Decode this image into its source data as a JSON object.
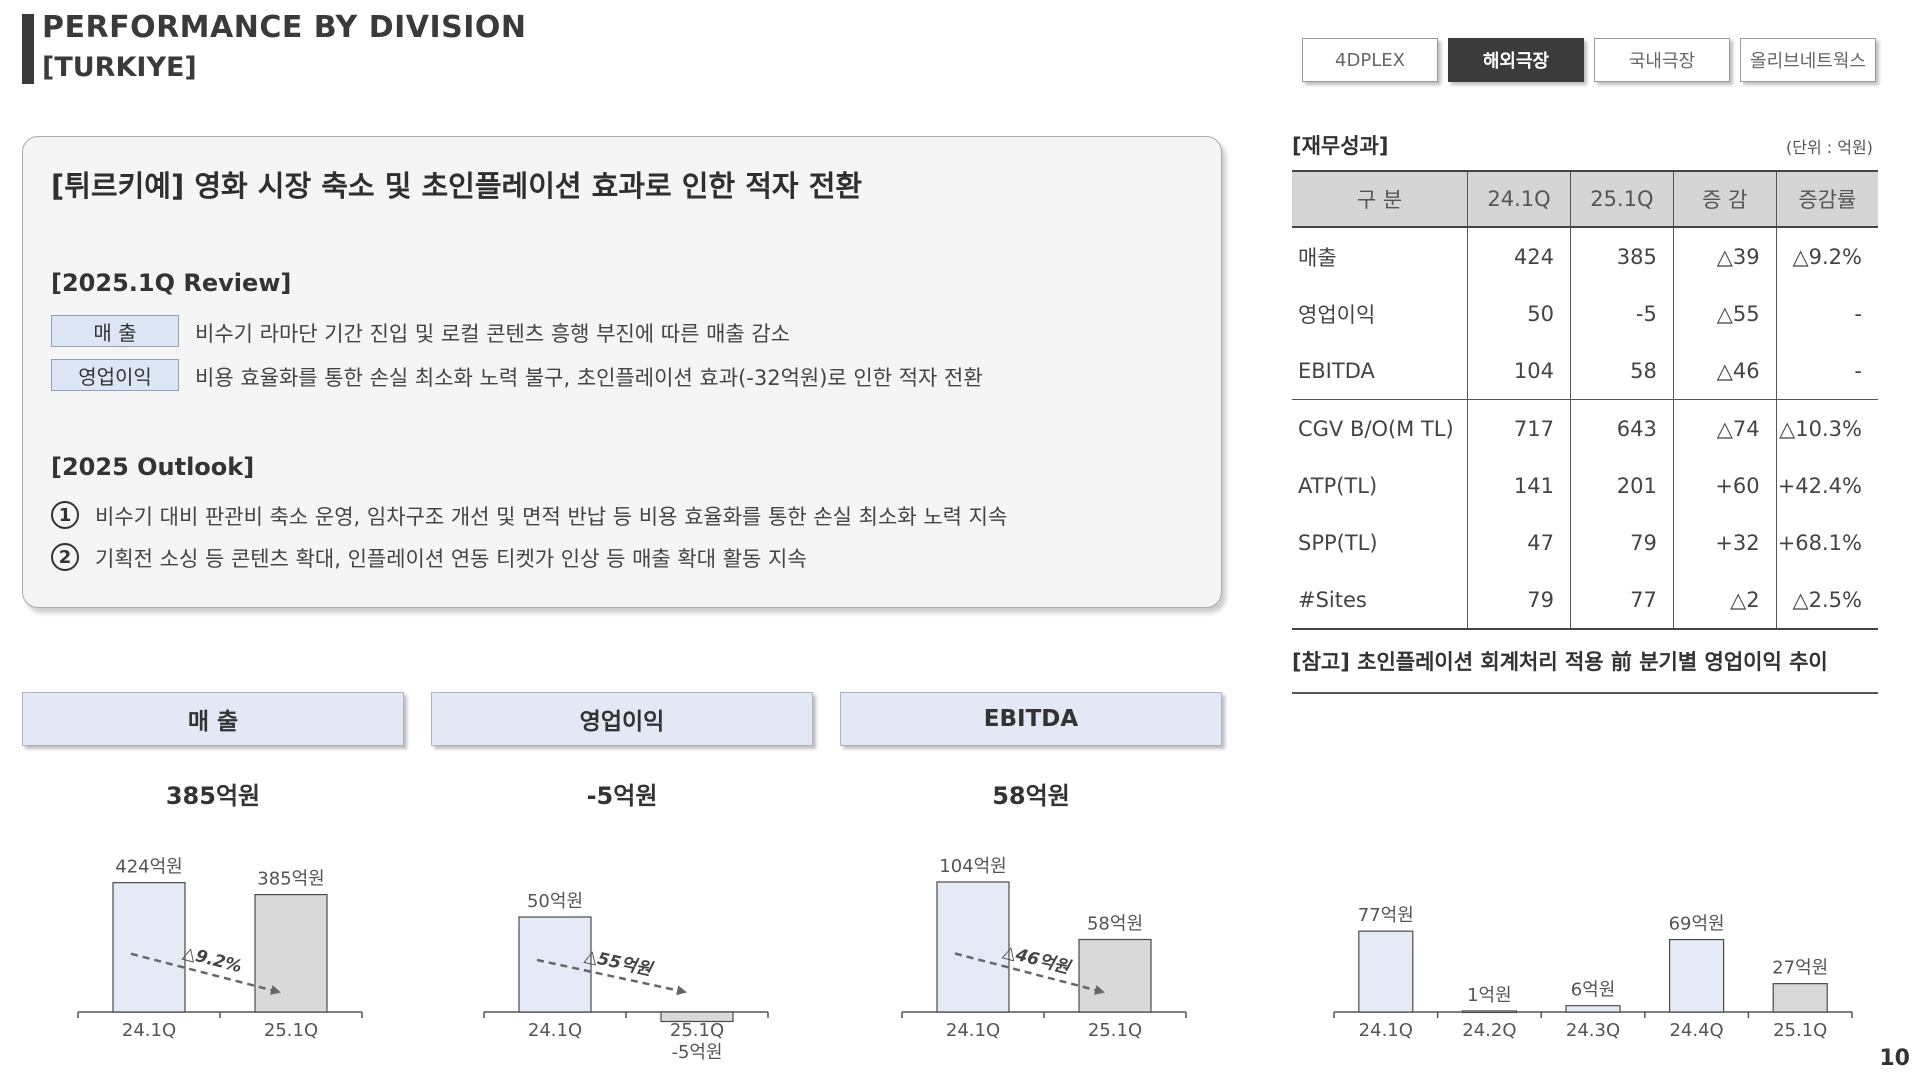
{
  "header": {
    "title_line1": "PERFORMANCE BY DIVISION",
    "title_line2": "[TURKIYE]"
  },
  "tabs": [
    {
      "label": "4DPLEX",
      "active": false
    },
    {
      "label": "해외극장",
      "active": true
    },
    {
      "label": "국내극장",
      "active": false
    },
    {
      "label": "올리브네트웍스",
      "active": false
    }
  ],
  "review": {
    "headline": "[튀르키예] 영화 시장 축소 및 초인플레이션 효과로 인한 적자 전환",
    "q_title": "[2025.1Q Review]",
    "q_items": [
      {
        "tag": "매  출",
        "text": "비수기 라마단 기간 진입 및 로컬 콘텐츠 흥행 부진에 따른 매출 감소"
      },
      {
        "tag": "영업이익",
        "text": "비용 효율화를 통한 손실 최소화 노력 불구, 초인플레이션 효과(-32억원)로 인한 적자 전환"
      }
    ],
    "outlook_title": "[2025 Outlook]",
    "outlook_items": [
      {
        "num": "1",
        "text": "비수기 대비 판관비 축소 운영, 임차구조 개선 및 면적 반납 등 비용 효율화를 통한 손실 최소화 노력 지속"
      },
      {
        "num": "2",
        "text": "기획전 소싱 등 콘텐츠 확대, 인플레이션 연동 티켓가 인상 등 매출 확대 활동 지속"
      }
    ]
  },
  "table": {
    "title": "[재무성과]",
    "unit": "(단위 : 억원)",
    "headers": [
      "구 분",
      "24.1Q",
      "25.1Q",
      "증 감",
      "증감률"
    ],
    "rows": [
      [
        "매출",
        "424",
        "385",
        "△39",
        "△9.2%"
      ],
      [
        "영업이익",
        "50",
        "-5",
        "△55",
        "-"
      ],
      [
        "EBITDA",
        "104",
        "58",
        "△46",
        "-"
      ],
      [
        "CGV B/O(M TL)",
        "717",
        "643",
        "△74",
        "△10.3%"
      ],
      [
        "ATP(TL)",
        "141",
        "201",
        "+60",
        "+42.4%"
      ],
      [
        "SPP(TL)",
        "47",
        "79",
        "+32",
        "+68.1%"
      ],
      [
        "#Sites",
        "79",
        "77",
        "△2",
        "△2.5%"
      ]
    ]
  },
  "reference": {
    "title": "[참고] 초인플레이션 회계처리 적용 前 분기별 영업이익 추이"
  },
  "metrics": [
    {
      "label": "매    출",
      "value": "385억원"
    },
    {
      "label": "영업이익",
      "value": "-5억원"
    },
    {
      "label": "EBITDA",
      "value": "58억원"
    }
  ],
  "page_number": "10",
  "colors": {
    "bar_prev": "#e4ebf6",
    "bar_curr": "#d9d9d9",
    "bar_border": "#4a4a4a",
    "active_tab": "#3b3b3b"
  },
  "chart_data": [
    {
      "type": "bar",
      "title": "매출",
      "categories": [
        "24.1Q",
        "25.1Q"
      ],
      "values": [
        424,
        385
      ],
      "data_labels": [
        "424억원",
        "385억원"
      ],
      "change_label": "△9.2%"
    },
    {
      "type": "bar",
      "title": "영업이익",
      "categories": [
        "24.1Q",
        "25.1Q"
      ],
      "values": [
        50,
        -5
      ],
      "data_labels": [
        "50억원",
        "-5억원"
      ],
      "change_label": "△55억원"
    },
    {
      "type": "bar",
      "title": "EBITDA",
      "categories": [
        "24.1Q",
        "25.1Q"
      ],
      "values": [
        104,
        58
      ],
      "data_labels": [
        "104억원",
        "58억원"
      ],
      "change_label": "△46억원"
    },
    {
      "type": "bar",
      "title": "[참고] 초인플레이션 회계처리 적용 前 분기별 영업이익 추이",
      "categories": [
        "24.1Q",
        "24.2Q",
        "24.3Q",
        "24.4Q",
        "25.1Q"
      ],
      "values": [
        77,
        1,
        6,
        69,
        27
      ],
      "data_labels": [
        "77억원",
        "1억원",
        "6억원",
        "69억원",
        "27억원"
      ]
    }
  ]
}
